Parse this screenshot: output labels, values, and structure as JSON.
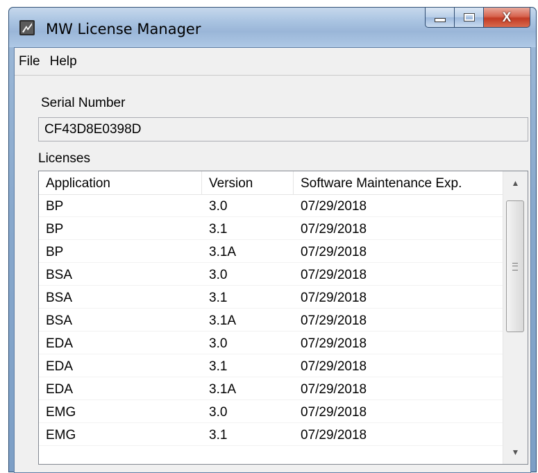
{
  "window": {
    "title": "MW License Manager",
    "icon": "app-logo-icon",
    "controls": {
      "minimize": "minimize-icon",
      "maximize": "maximize-icon",
      "close_label": "X"
    }
  },
  "menu": {
    "items": [
      "File",
      "Help"
    ]
  },
  "serial": {
    "label": "Serial Number",
    "value": "CF43D8E0398D"
  },
  "licenses": {
    "label": "Licenses",
    "columns": [
      "Application",
      "Version",
      "Software Maintenance Exp."
    ],
    "rows": [
      [
        "BP",
        "3.0",
        "07/29/2018"
      ],
      [
        "BP",
        "3.1",
        "07/29/2018"
      ],
      [
        "BP",
        "3.1A",
        "07/29/2018"
      ],
      [
        "BSA",
        "3.0",
        "07/29/2018"
      ],
      [
        "BSA",
        "3.1",
        "07/29/2018"
      ],
      [
        "BSA",
        "3.1A",
        "07/29/2018"
      ],
      [
        "EDA",
        "3.0",
        "07/29/2018"
      ],
      [
        "EDA",
        "3.1",
        "07/29/2018"
      ],
      [
        "EDA",
        "3.1A",
        "07/29/2018"
      ],
      [
        "EMG",
        "3.0",
        "07/29/2018"
      ],
      [
        "EMG",
        "3.1",
        "07/29/2018"
      ]
    ],
    "scrollbar": {
      "up_arrow": "▲",
      "down_arrow": "▼"
    }
  },
  "colors": {
    "title_bar": "#a9c3e1",
    "close_button": "#c23b24",
    "client_bg": "#f0f0f0"
  }
}
